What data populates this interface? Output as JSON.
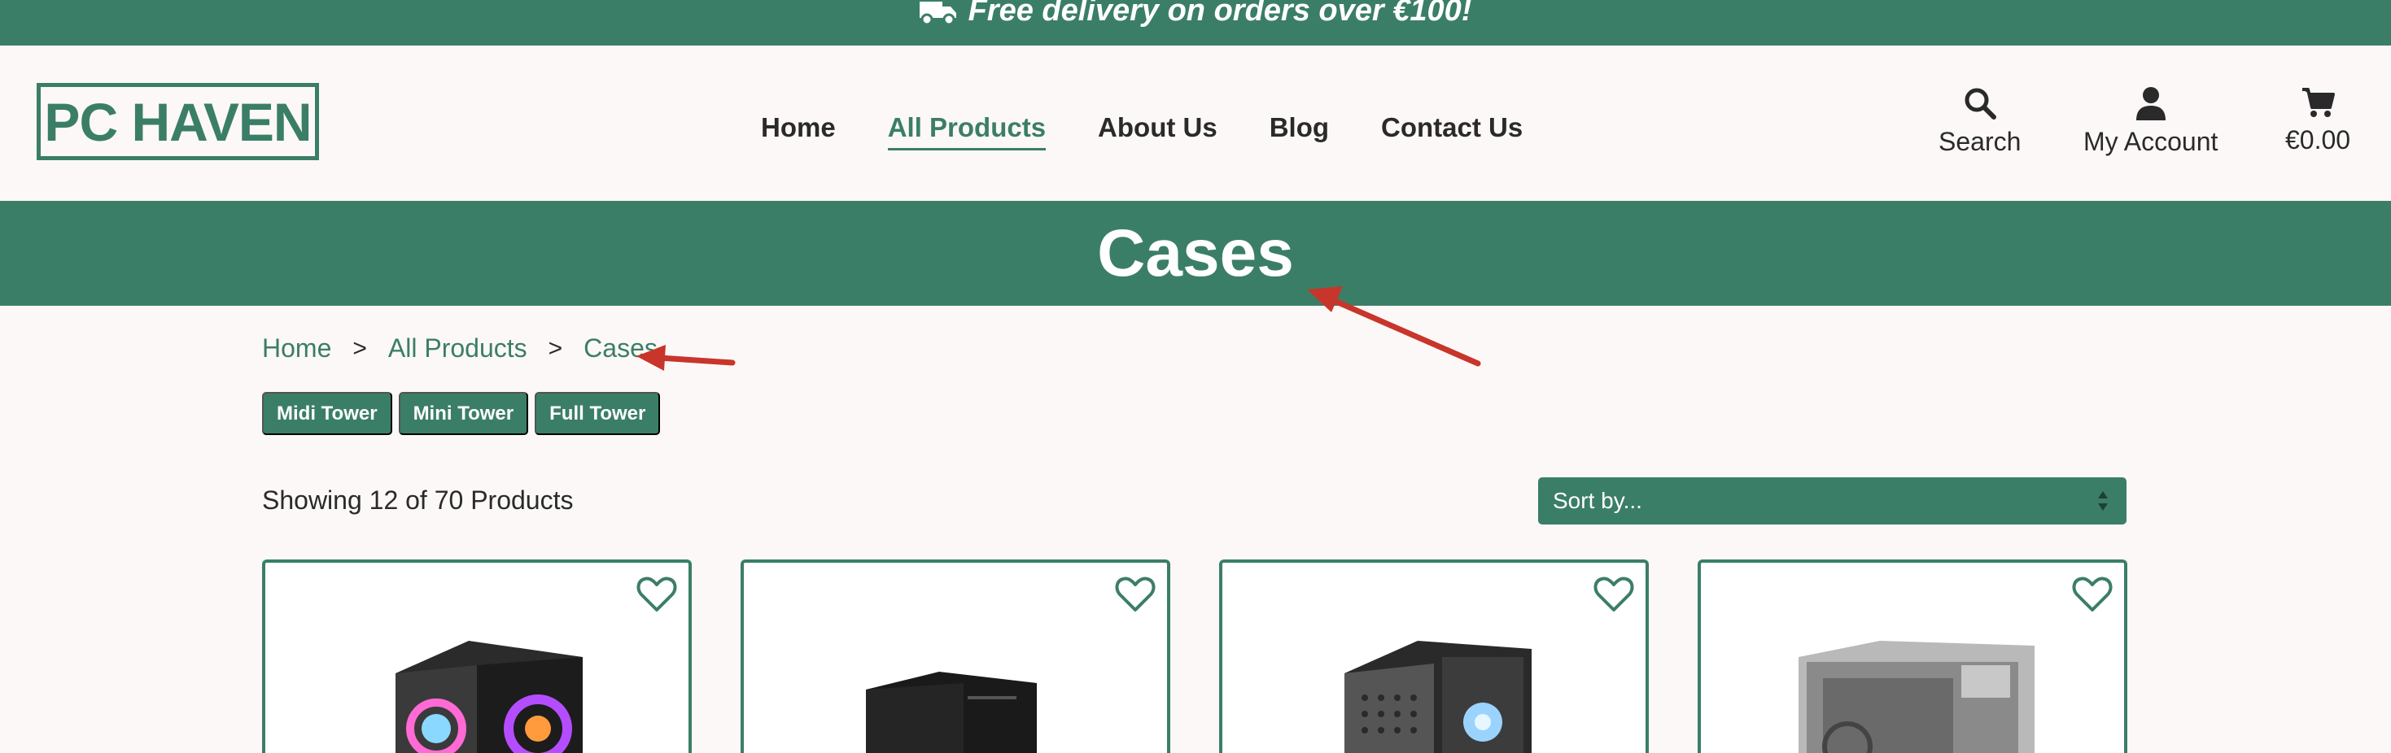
{
  "promo": {
    "text": "Free delivery on orders over €100!",
    "icon": "truck-icon"
  },
  "header": {
    "logo": "PC HAVEN",
    "nav": [
      {
        "label": "Home",
        "active": false
      },
      {
        "label": "All Products",
        "active": true
      },
      {
        "label": "About Us",
        "active": false
      },
      {
        "label": "Blog",
        "active": false
      },
      {
        "label": "Contact Us",
        "active": false
      }
    ],
    "actions": {
      "search": {
        "label": "Search",
        "icon": "search-icon"
      },
      "account": {
        "label": "My Account",
        "icon": "user-icon"
      },
      "cart": {
        "label": "€0.00",
        "icon": "cart-icon"
      }
    }
  },
  "banner": {
    "title": "Cases"
  },
  "breadcrumb": [
    "Home",
    "All Products",
    "Cases"
  ],
  "breadcrumb_separator": ">",
  "filters": [
    "Midi Tower",
    "Mini Tower",
    "Full Tower"
  ],
  "listing": {
    "showing": "Showing 12 of 70 Products",
    "sort_placeholder": "Sort by..."
  },
  "colors": {
    "brand": "#3b7e67",
    "background": "#fcf8f7",
    "annotation": "#c8352a"
  },
  "products": [
    {
      "icon": "wishlist-heart-icon",
      "image": "rgb-glass-case"
    },
    {
      "icon": "wishlist-heart-icon",
      "image": "black-mesh-case"
    },
    {
      "icon": "wishlist-heart-icon",
      "image": "mesh-glass-case"
    },
    {
      "icon": "wishlist-heart-icon",
      "image": "silver-glass-case"
    }
  ]
}
